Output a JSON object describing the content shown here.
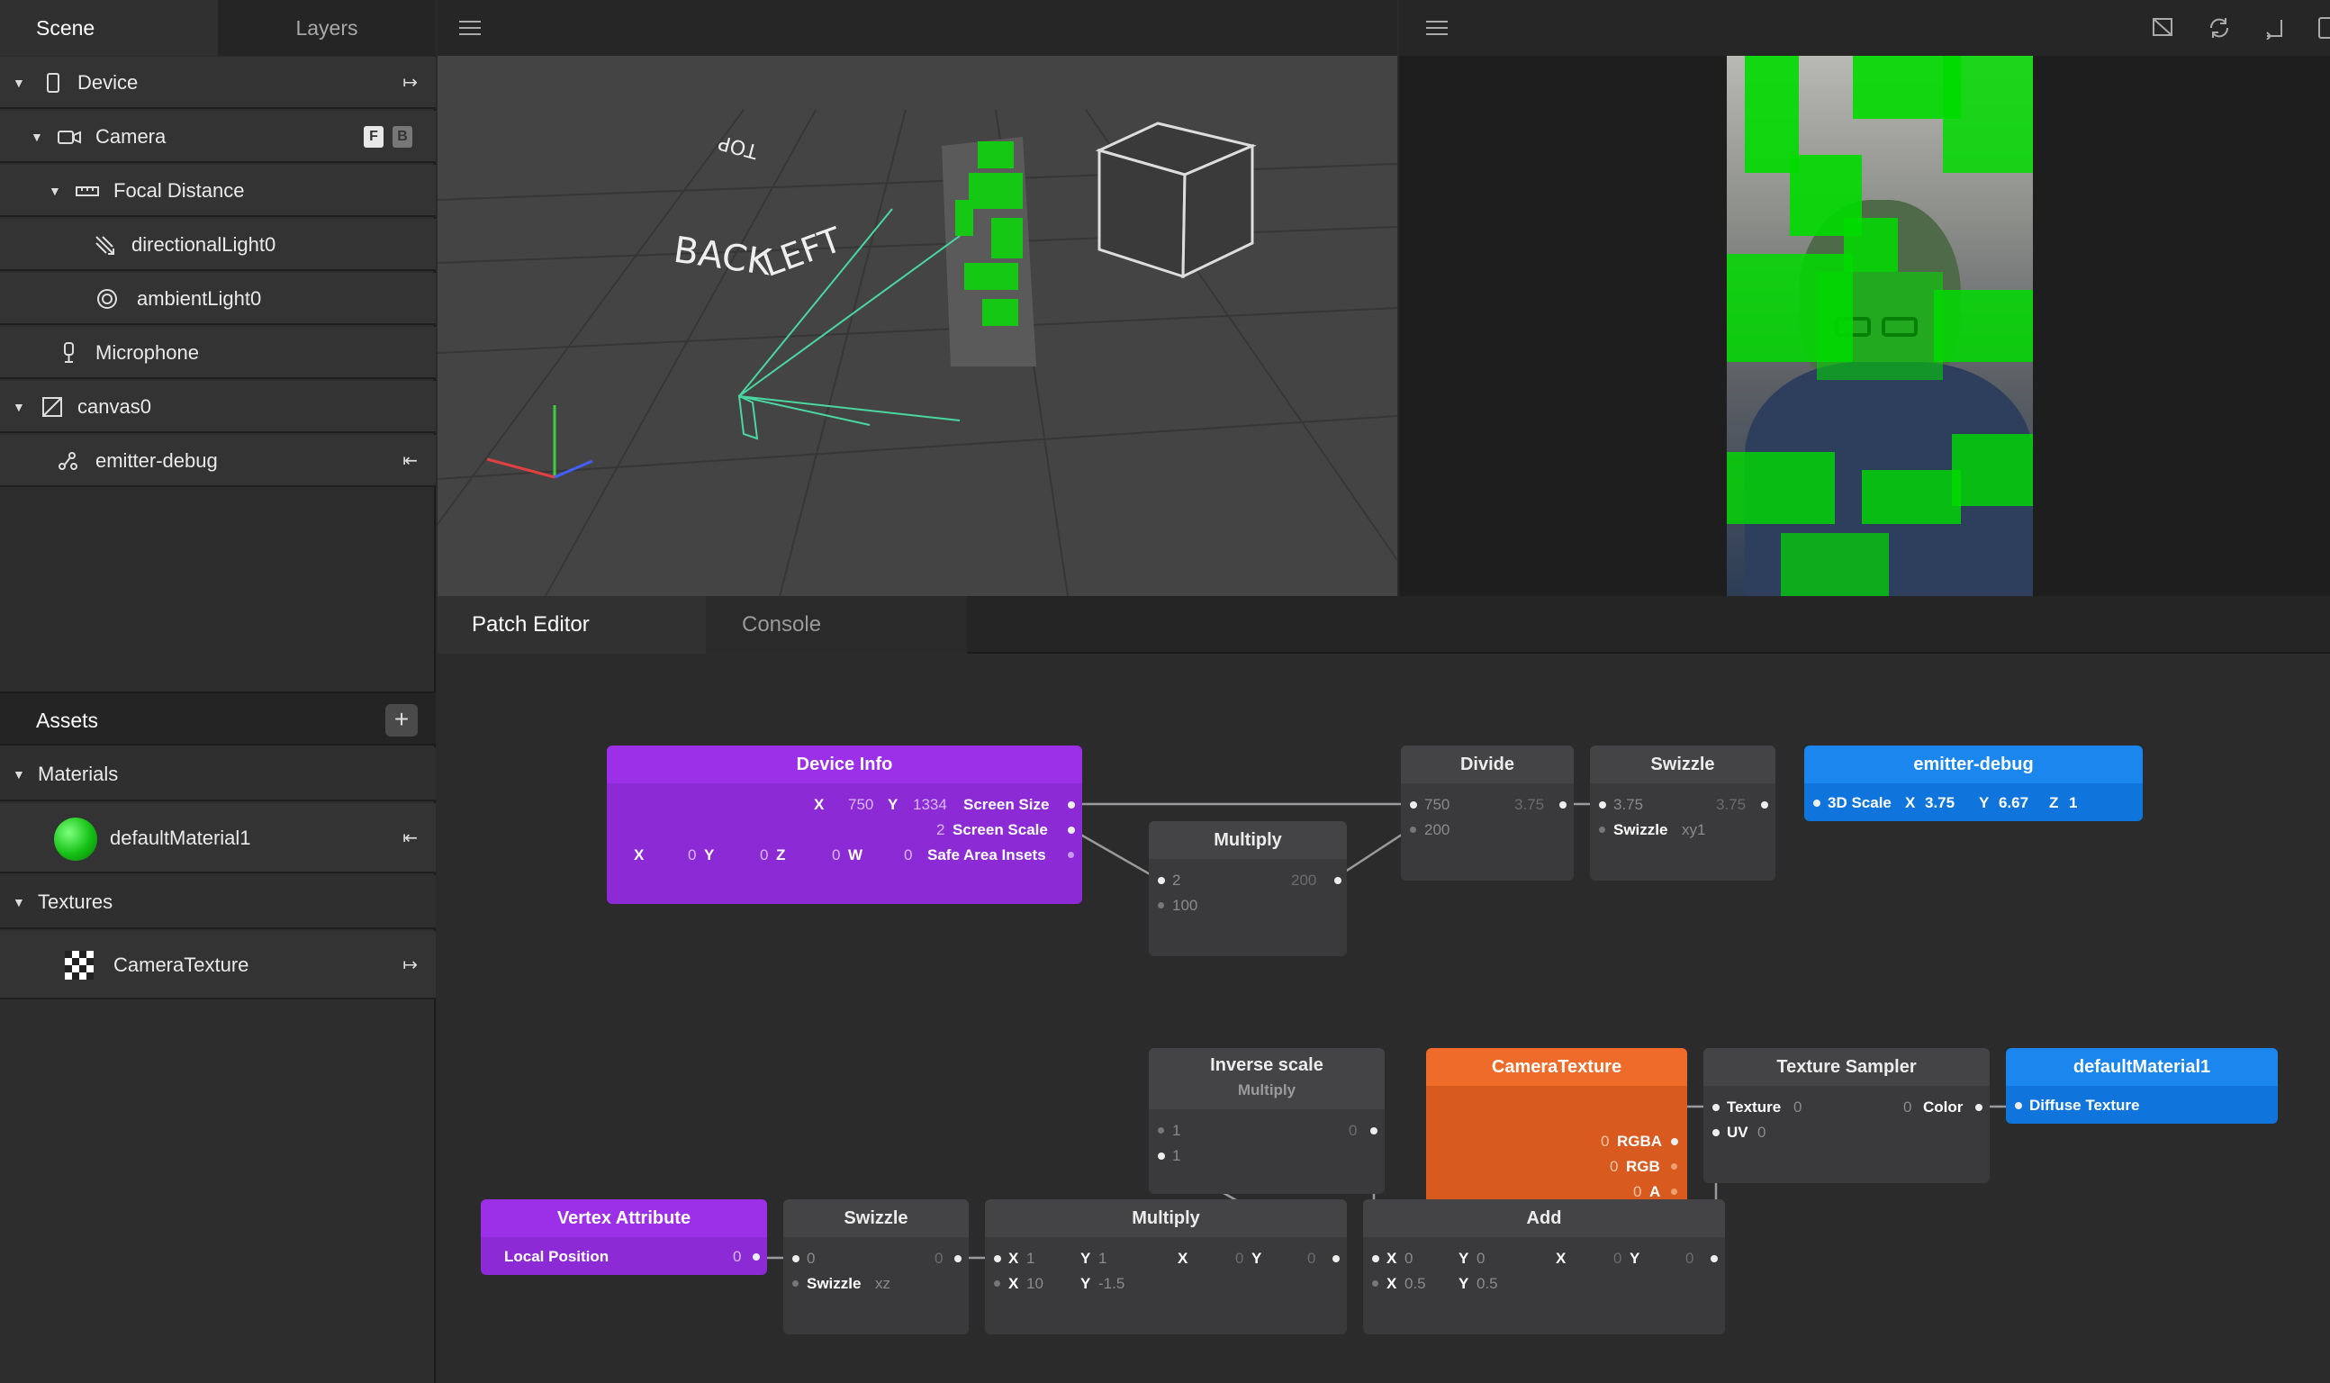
{
  "scene_tabs": {
    "scene": "Scene",
    "layers": "Layers"
  },
  "scene_tree": [
    {
      "label": "Device"
    },
    {
      "label": "Camera",
      "badge_f": "F",
      "badge_b": "B"
    },
    {
      "label": "Focal Distance"
    },
    {
      "label": "directionalLight0"
    },
    {
      "label": "ambientLight0"
    },
    {
      "label": "Microphone"
    },
    {
      "label": "canvas0"
    },
    {
      "label": "emitter-debug"
    }
  ],
  "assets": {
    "title": "Assets",
    "add": "+",
    "materials_label": "Materials",
    "material": "defaultMaterial1",
    "textures_label": "Textures",
    "texture": "CameraTexture"
  },
  "viewport": {
    "cube_back": "BACK",
    "cube_left": "LEFT",
    "cube_top": "TOP"
  },
  "bottom_tabs": {
    "patch": "Patch Editor",
    "console": "Console"
  },
  "patches": {
    "device_info": {
      "title": "Device Info",
      "sx": "X",
      "sx_v": "750",
      "sy": "Y",
      "sy_v": "1334",
      "screen_size": "Screen Size",
      "scale_v": "2",
      "screen_scale": "Screen Scale",
      "x": "X",
      "xv": "0",
      "y": "Y",
      "yv": "0",
      "z": "Z",
      "zv": "0",
      "w": "W",
      "wv": "0",
      "safe": "Safe Area Insets"
    },
    "divide": {
      "title": "Divide",
      "a": "750",
      "b": "200",
      "out": "3.75"
    },
    "swizzle1": {
      "title": "Swizzle",
      "in": "3.75",
      "out": "3.75",
      "label": "Swizzle",
      "val": "xy1"
    },
    "emitter": {
      "title": "emitter-debug",
      "label": "3D Scale",
      "x": "X",
      "xv": "3.75",
      "y": "Y",
      "yv": "6.67",
      "z": "Z",
      "zv": "1"
    },
    "multiply1": {
      "title": "Multiply",
      "a": "2",
      "b": "100",
      "out": "200"
    },
    "inverse": {
      "title": "Inverse scale",
      "sub": "Multiply",
      "a": "1",
      "b": "1",
      "out": "0"
    },
    "cam_tex": {
      "title": "CameraTexture",
      "rgba": "RGBA",
      "rgb": "RGB",
      "a": "A",
      "z1": "0",
      "z2": "0",
      "z3": "0"
    },
    "sampler": {
      "title": "Texture Sampler",
      "tex": "Texture",
      "tex_v": "0",
      "uv": "UV",
      "uv_v": "0",
      "color": "Color",
      "color_v": "0"
    },
    "material": {
      "title": "defaultMaterial1",
      "label": "Diffuse Texture"
    },
    "vertex": {
      "title": "Vertex Attribute",
      "label": "Local Position",
      "out": "0"
    },
    "swizzle2": {
      "title": "Swizzle",
      "in": "0",
      "out": "0",
      "label": "Swizzle",
      "val": "xz"
    },
    "multiply2": {
      "title": "Multiply",
      "x1": "X",
      "x1v": "1",
      "y1": "Y",
      "y1v": "1",
      "x2": "X",
      "x2v": "10",
      "y2": "Y",
      "y2v": "-1.5",
      "ox": "X",
      "oxv": "0",
      "oy": "Y",
      "oyv": "0"
    },
    "add": {
      "title": "Add",
      "x1": "X",
      "x1v": "0",
      "y1": "Y",
      "y1v": "0",
      "x2": "X",
      "x2v": "0.5",
      "y2": "Y",
      "y2v": "0.5",
      "ox": "X",
      "oxv": "0",
      "oy": "Y",
      "oyv": "0"
    }
  }
}
